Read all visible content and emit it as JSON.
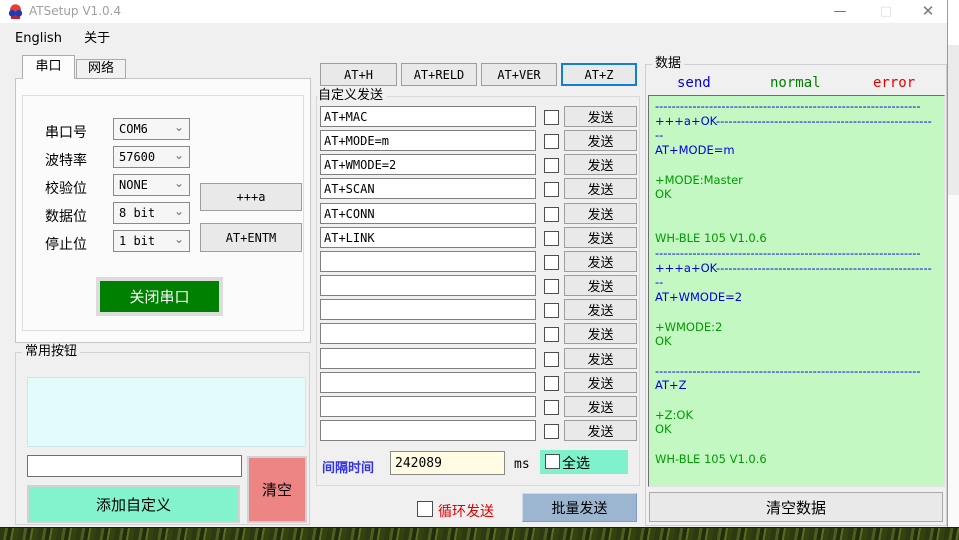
{
  "window": {
    "title": "ATSetup V1.0.4",
    "controls": {
      "minimize": "—",
      "maximize": "□",
      "close": "✕"
    }
  },
  "menu": {
    "items": [
      "English",
      "关于"
    ]
  },
  "serial_panel": {
    "tabs": [
      {
        "label": "串口",
        "active": true
      },
      {
        "label": "网络",
        "active": false
      }
    ],
    "fields": [
      {
        "label": "串口号",
        "value": "COM6"
      },
      {
        "label": "波特率",
        "value": "57600"
      },
      {
        "label": "校验位",
        "value": "NONE"
      },
      {
        "label": "数据位",
        "value": "8 bit"
      },
      {
        "label": "停止位",
        "value": "1 bit"
      }
    ],
    "exit_transparent_button": "+++a",
    "entm_button": "AT+ENTM",
    "close_serial_button": "关闭串口"
  },
  "common_buttons": {
    "group_label": "常用按钮",
    "input_value": "",
    "add_button": "添加自定义",
    "clear_button": "清空"
  },
  "quick_commands": [
    {
      "label": "AT+H"
    },
    {
      "label": "AT+RELD"
    },
    {
      "label": "AT+VER"
    },
    {
      "label": "AT+Z",
      "focused": true
    }
  ],
  "custom_send": {
    "group_label": "自定义发送",
    "send_button_label": "发送",
    "rows": [
      {
        "value": "AT+MAC",
        "checked": false
      },
      {
        "value": "AT+MODE=m",
        "checked": false
      },
      {
        "value": "AT+WMODE=2",
        "checked": false
      },
      {
        "value": "AT+SCAN",
        "checked": false
      },
      {
        "value": "AT+CONN",
        "checked": false
      },
      {
        "value": "AT+LINK",
        "checked": false
      },
      {
        "value": "",
        "checked": false
      },
      {
        "value": "",
        "checked": false
      },
      {
        "value": "",
        "checked": false
      },
      {
        "value": "",
        "checked": false
      },
      {
        "value": "",
        "checked": false
      },
      {
        "value": "",
        "checked": false
      },
      {
        "value": "",
        "checked": false
      },
      {
        "value": "",
        "checked": false
      }
    ],
    "interval_label": "间隔时间",
    "interval_value": "242089",
    "interval_unit": "ms",
    "select_all_label": "全选",
    "select_all_checked": false,
    "loop_send_label": "循环发送",
    "loop_send_checked": false,
    "batch_send_button": "批量发送"
  },
  "data_panel": {
    "group_label": "数据",
    "legend": [
      {
        "label": "send",
        "color": "#0000e1"
      },
      {
        "label": "normal",
        "color": "#008000"
      },
      {
        "label": "error",
        "color": "#e60000"
      }
    ],
    "log": [
      {
        "type": "send",
        "text": "----------------------------------------------------------------"
      },
      {
        "type": "send",
        "text": "+++a+OK----------------------------------------------------"
      },
      {
        "type": "send",
        "text": "--"
      },
      {
        "type": "send",
        "text": "AT+MODE=m"
      },
      {
        "type": "blank",
        "text": ""
      },
      {
        "type": "normal",
        "text": "+MODE:Master"
      },
      {
        "type": "normal",
        "text": "OK"
      },
      {
        "type": "blank",
        "text": ""
      },
      {
        "type": "blank",
        "text": ""
      },
      {
        "type": "normal",
        "text": "WH-BLE 105 V1.0.6"
      },
      {
        "type": "send",
        "text": "----------------------------------------------------------------"
      },
      {
        "type": "send",
        "text": "+++a+OK----------------------------------------------------"
      },
      {
        "type": "send",
        "text": "--"
      },
      {
        "type": "send",
        "text": "AT+WMODE=2"
      },
      {
        "type": "blank",
        "text": ""
      },
      {
        "type": "normal",
        "text": "+WMODE:2"
      },
      {
        "type": "normal",
        "text": "OK"
      },
      {
        "type": "blank",
        "text": ""
      },
      {
        "type": "send",
        "text": "----------------------------------------------------------------"
      },
      {
        "type": "send",
        "text": "AT+Z"
      },
      {
        "type": "blank",
        "text": ""
      },
      {
        "type": "normal",
        "text": "+Z:OK"
      },
      {
        "type": "normal",
        "text": "OK"
      },
      {
        "type": "blank",
        "text": ""
      },
      {
        "type": "normal",
        "text": "WH-BLE 105 V1.0.6"
      }
    ],
    "clear_button": "清空数据"
  },
  "colors": {
    "send": "#0000e1",
    "normal": "#009a00",
    "error": "#e60000",
    "log_bg": "#c3f8c3",
    "close_serial_bg": "#008000",
    "add_custom_bg": "#83f3cd",
    "clear_bg": "#ee8585",
    "batch_send_bg": "#9cb6d1",
    "select_all_bg": "#7ff2cd",
    "interval_input_bg": "#fffce3",
    "interval_label_text": "#3333e6",
    "loop_send_text": "#e00000"
  }
}
